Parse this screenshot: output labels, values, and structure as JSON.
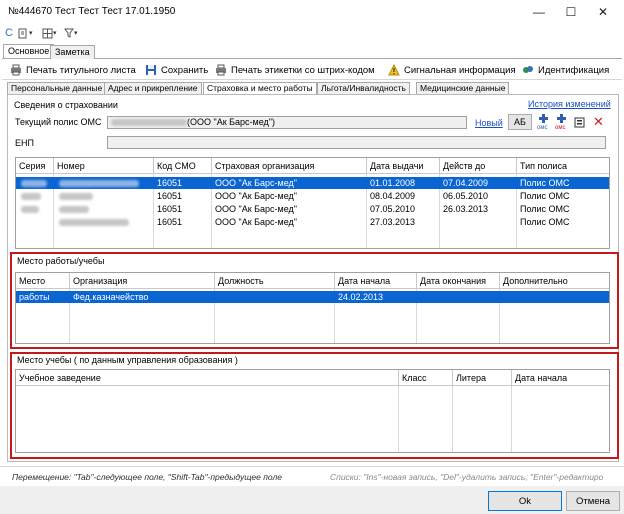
{
  "window": {
    "title": "№444670 Тест Тест Тест 17.01.1950",
    "minimize": "—",
    "maximize": "☐",
    "close": "✕"
  },
  "quick_access": {
    "refresh": "C",
    "doc": "▾",
    "grid": "▾",
    "filter": "▾"
  },
  "main_tabs": [
    {
      "label": "Основное"
    },
    {
      "label": "Заметка"
    }
  ],
  "toolbar": {
    "print_title": "Печать титульного листа",
    "save": "Сохранить",
    "print_labels": "Печать этикетки со штрих-кодом",
    "signal": "Сигнальная информация",
    "identification": "Идентификация"
  },
  "sub_tabs": [
    {
      "label": "Персональные данные"
    },
    {
      "label": "Адрес и прикрепление"
    },
    {
      "label": "Страховка и место работы"
    },
    {
      "label": "Льгота/Инвалидность"
    },
    {
      "label": "Медицинские данные"
    }
  ],
  "insurance": {
    "section_title": "Сведения о страховании",
    "history_link": "История изменений",
    "current_policy_label": "Текущий полис ОМС",
    "current_policy_value": "(ООО \"Ак Барс-мед\")",
    "new_link": "Новый",
    "ab_button": "АБ",
    "omc1": "омс",
    "omc2": "омс",
    "enp_label": "ЕНП",
    "headers": [
      "Серия",
      "Номер",
      "Код СМО",
      "Страховая организация",
      "Дата выдачи",
      "Действ до",
      "Тип полиса"
    ],
    "rows": [
      {
        "smo": "16051",
        "org": "ООО \"Ак Барс-мед\"",
        "issued": "01.01.2008",
        "valid": "07.04.2009",
        "type": "Полис ОМС"
      },
      {
        "smo": "16051",
        "org": "ООО \"Ак Барс-мед\"",
        "issued": "08.04.2009",
        "valid": "06.05.2010",
        "type": "Полис ОМС"
      },
      {
        "smo": "16051",
        "org": "ООО \"Ак Барс-мед\"",
        "issued": "07.05.2010",
        "valid": "26.03.2013",
        "type": "Полис ОМС"
      },
      {
        "smo": "16051",
        "org": "ООО \"Ак Барс-мед\"",
        "issued": "27.03.2013",
        "valid": "",
        "type": "Полис ОМС"
      }
    ]
  },
  "work": {
    "section_title": "Место работы/учебы",
    "headers": [
      "Место",
      "Организация",
      "Должность",
      "Дата начала",
      "Дата окончания",
      "Дополнительно"
    ],
    "rows": [
      {
        "place": "работы",
        "org": "Фед.казначейство",
        "position": "",
        "start": "24.02.2013",
        "end": "",
        "extra": ""
      }
    ]
  },
  "study": {
    "section_title": "Место учебы ( по данным управления образования )",
    "headers": [
      "Учебное заведение",
      "Класс",
      "Литера",
      "Дата начала"
    ]
  },
  "status": {
    "navigation_hint": "Перемещение: \"Tab\"-следующее поле, \"Shift-Tab\"-предыдущее поле",
    "list_hint": "Списки: \"Ins\"-новая запись, \"Del\"-удалить запись; \"Enter\"-редактиро"
  },
  "buttons": {
    "ok": "Ok",
    "cancel": "Отмена"
  },
  "colors": {
    "selection": "#0a64d2",
    "highlight_box": "#c21a1a",
    "link": "#1a4fbf"
  }
}
